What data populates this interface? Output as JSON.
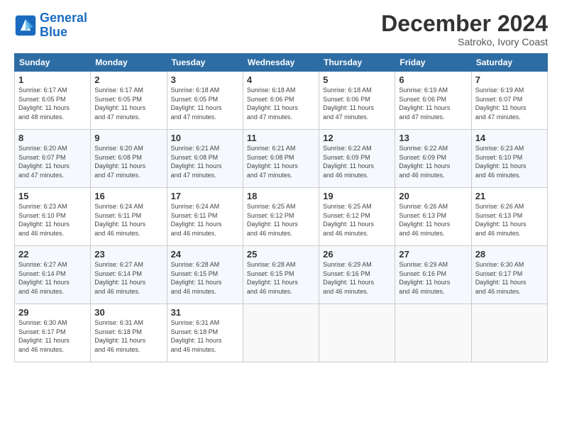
{
  "logo": {
    "line1": "General",
    "line2": "Blue"
  },
  "title": "December 2024",
  "subtitle": "Satroko, Ivory Coast",
  "days_header": [
    "Sunday",
    "Monday",
    "Tuesday",
    "Wednesday",
    "Thursday",
    "Friday",
    "Saturday"
  ],
  "weeks": [
    [
      {
        "day": "1",
        "info": "Sunrise: 6:17 AM\nSunset: 6:05 PM\nDaylight: 11 hours\nand 48 minutes."
      },
      {
        "day": "2",
        "info": "Sunrise: 6:17 AM\nSunset: 6:05 PM\nDaylight: 11 hours\nand 47 minutes."
      },
      {
        "day": "3",
        "info": "Sunrise: 6:18 AM\nSunset: 6:05 PM\nDaylight: 11 hours\nand 47 minutes."
      },
      {
        "day": "4",
        "info": "Sunrise: 6:18 AM\nSunset: 6:06 PM\nDaylight: 11 hours\nand 47 minutes."
      },
      {
        "day": "5",
        "info": "Sunrise: 6:18 AM\nSunset: 6:06 PM\nDaylight: 11 hours\nand 47 minutes."
      },
      {
        "day": "6",
        "info": "Sunrise: 6:19 AM\nSunset: 6:06 PM\nDaylight: 11 hours\nand 47 minutes."
      },
      {
        "day": "7",
        "info": "Sunrise: 6:19 AM\nSunset: 6:07 PM\nDaylight: 11 hours\nand 47 minutes."
      }
    ],
    [
      {
        "day": "8",
        "info": "Sunrise: 6:20 AM\nSunset: 6:07 PM\nDaylight: 11 hours\nand 47 minutes."
      },
      {
        "day": "9",
        "info": "Sunrise: 6:20 AM\nSunset: 6:08 PM\nDaylight: 11 hours\nand 47 minutes."
      },
      {
        "day": "10",
        "info": "Sunrise: 6:21 AM\nSunset: 6:08 PM\nDaylight: 11 hours\nand 47 minutes."
      },
      {
        "day": "11",
        "info": "Sunrise: 6:21 AM\nSunset: 6:08 PM\nDaylight: 11 hours\nand 47 minutes."
      },
      {
        "day": "12",
        "info": "Sunrise: 6:22 AM\nSunset: 6:09 PM\nDaylight: 11 hours\nand 46 minutes."
      },
      {
        "day": "13",
        "info": "Sunrise: 6:22 AM\nSunset: 6:09 PM\nDaylight: 11 hours\nand 46 minutes."
      },
      {
        "day": "14",
        "info": "Sunrise: 6:23 AM\nSunset: 6:10 PM\nDaylight: 11 hours\nand 46 minutes."
      }
    ],
    [
      {
        "day": "15",
        "info": "Sunrise: 6:23 AM\nSunset: 6:10 PM\nDaylight: 11 hours\nand 46 minutes."
      },
      {
        "day": "16",
        "info": "Sunrise: 6:24 AM\nSunset: 6:11 PM\nDaylight: 11 hours\nand 46 minutes."
      },
      {
        "day": "17",
        "info": "Sunrise: 6:24 AM\nSunset: 6:11 PM\nDaylight: 11 hours\nand 46 minutes."
      },
      {
        "day": "18",
        "info": "Sunrise: 6:25 AM\nSunset: 6:12 PM\nDaylight: 11 hours\nand 46 minutes."
      },
      {
        "day": "19",
        "info": "Sunrise: 6:25 AM\nSunset: 6:12 PM\nDaylight: 11 hours\nand 46 minutes."
      },
      {
        "day": "20",
        "info": "Sunrise: 6:26 AM\nSunset: 6:13 PM\nDaylight: 11 hours\nand 46 minutes."
      },
      {
        "day": "21",
        "info": "Sunrise: 6:26 AM\nSunset: 6:13 PM\nDaylight: 11 hours\nand 46 minutes."
      }
    ],
    [
      {
        "day": "22",
        "info": "Sunrise: 6:27 AM\nSunset: 6:14 PM\nDaylight: 11 hours\nand 46 minutes."
      },
      {
        "day": "23",
        "info": "Sunrise: 6:27 AM\nSunset: 6:14 PM\nDaylight: 11 hours\nand 46 minutes."
      },
      {
        "day": "24",
        "info": "Sunrise: 6:28 AM\nSunset: 6:15 PM\nDaylight: 11 hours\nand 46 minutes."
      },
      {
        "day": "25",
        "info": "Sunrise: 6:28 AM\nSunset: 6:15 PM\nDaylight: 11 hours\nand 46 minutes."
      },
      {
        "day": "26",
        "info": "Sunrise: 6:29 AM\nSunset: 6:16 PM\nDaylight: 11 hours\nand 46 minutes."
      },
      {
        "day": "27",
        "info": "Sunrise: 6:29 AM\nSunset: 6:16 PM\nDaylight: 11 hours\nand 46 minutes."
      },
      {
        "day": "28",
        "info": "Sunrise: 6:30 AM\nSunset: 6:17 PM\nDaylight: 11 hours\nand 46 minutes."
      }
    ],
    [
      {
        "day": "29",
        "info": "Sunrise: 6:30 AM\nSunset: 6:17 PM\nDaylight: 11 hours\nand 46 minutes."
      },
      {
        "day": "30",
        "info": "Sunrise: 6:31 AM\nSunset: 6:18 PM\nDaylight: 11 hours\nand 46 minutes."
      },
      {
        "day": "31",
        "info": "Sunrise: 6:31 AM\nSunset: 6:18 PM\nDaylight: 11 hours\nand 46 minutes."
      },
      {
        "day": "",
        "info": ""
      },
      {
        "day": "",
        "info": ""
      },
      {
        "day": "",
        "info": ""
      },
      {
        "day": "",
        "info": ""
      }
    ]
  ]
}
